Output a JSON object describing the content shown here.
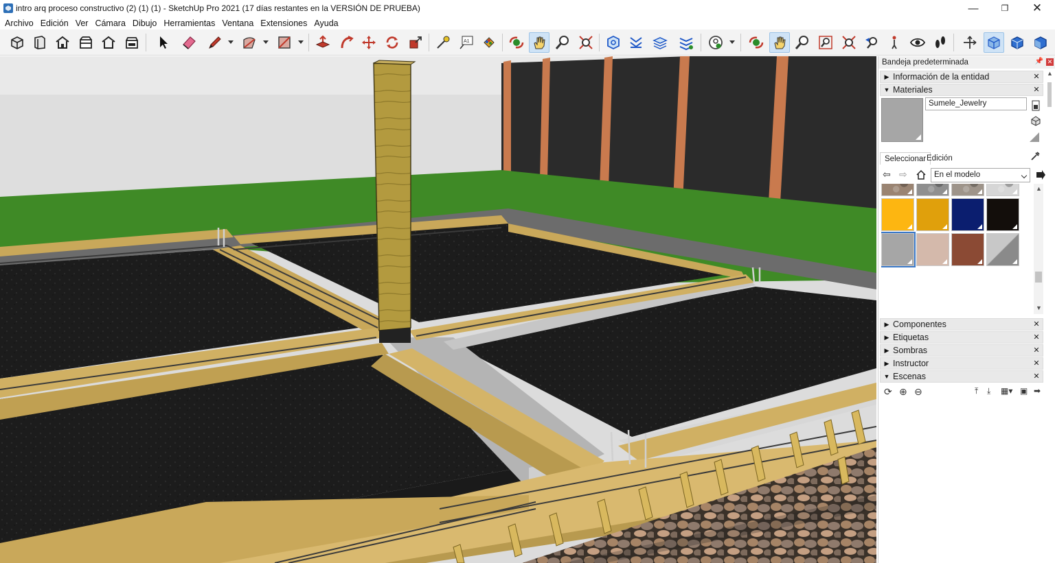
{
  "window": {
    "title": "intro arq proceso constructivo (2) (1) (1) - SketchUp Pro 2021 (17 días restantes en la VERSIÓN DE PRUEBA)",
    "minimize": "—",
    "maximize": "❐",
    "close": "✕"
  },
  "menu": [
    "Archivo",
    "Edición",
    "Ver",
    "Cámara",
    "Dibujo",
    "Herramientas",
    "Ventana",
    "Extensiones",
    "Ayuda"
  ],
  "toolbar": {
    "tools": [
      "iso-view",
      "top-view",
      "front-view",
      "right-view",
      "back-view",
      "left-view",
      "select",
      "eraser",
      "line",
      "arc",
      "rectangle",
      "push-pull",
      "follow-me",
      "move",
      "rotate",
      "scale",
      "tape-measure",
      "text",
      "paint-bucket",
      "orbit",
      "pan",
      "zoom",
      "zoom-extents",
      "outer-shell",
      "sections",
      "tags",
      "styles",
      "warehouse",
      "components",
      "orbit-2",
      "pan-2",
      "zoom-2",
      "zoom-window",
      "zoom-extents-2",
      "previous",
      "position-camera",
      "look-around",
      "walk",
      "axes",
      "xray",
      "back-edges",
      "wireframe"
    ],
    "active": [
      "pan",
      "pan-2",
      "xray"
    ]
  },
  "tray": {
    "header": "Bandeja predeterminada",
    "panels": {
      "entity_info": "Información de la entidad",
      "materials": "Materiales",
      "components": "Componentes",
      "tags": "Etiquetas",
      "shadows": "Sombras",
      "instructor": "Instructor",
      "scenes": "Escenas"
    },
    "material": {
      "name": "Sumele_Jewelry",
      "preview_color": "#a6a6a6",
      "tab_select": "Seleccionar",
      "tab_edit": "Edición",
      "collection": "En el modelo",
      "swatches": [
        {
          "color": "#9a8472",
          "kind": "stone"
        },
        {
          "color": "#8f8f8f",
          "kind": "gravel"
        },
        {
          "color": "#9e948a",
          "kind": "gravel"
        },
        {
          "color": "#d6d6d6",
          "kind": "gravel"
        },
        {
          "color": "#fdb611",
          "kind": "solid"
        },
        {
          "color": "#e0a00c",
          "kind": "solid"
        },
        {
          "color": "#0b1e6f",
          "kind": "solid"
        },
        {
          "color": "#130e0b",
          "kind": "solid"
        },
        {
          "color": "#a6a6a6",
          "kind": "solid"
        },
        {
          "color": "#d4b9ab",
          "kind": "solid"
        },
        {
          "color": "#8b4a34",
          "kind": "solid"
        },
        {
          "color": "#8a8a8a",
          "kind": "diagonal"
        }
      ],
      "selected_swatch": 8
    }
  },
  "viewport": {
    "scene": "foundation-model",
    "colors": {
      "sky": "#e8e8e8",
      "wall": "#dcdcdc",
      "grass": "#3f8a26",
      "soil": "#1b1b1b",
      "formwork": "#c9a85a",
      "concrete": "#b7b7b7",
      "column": "#b59a3e",
      "fence": "#2b2b2b",
      "post": "#c97a4e",
      "rebar": "#3a3a3a",
      "stones": "#9b7a5e"
    }
  }
}
